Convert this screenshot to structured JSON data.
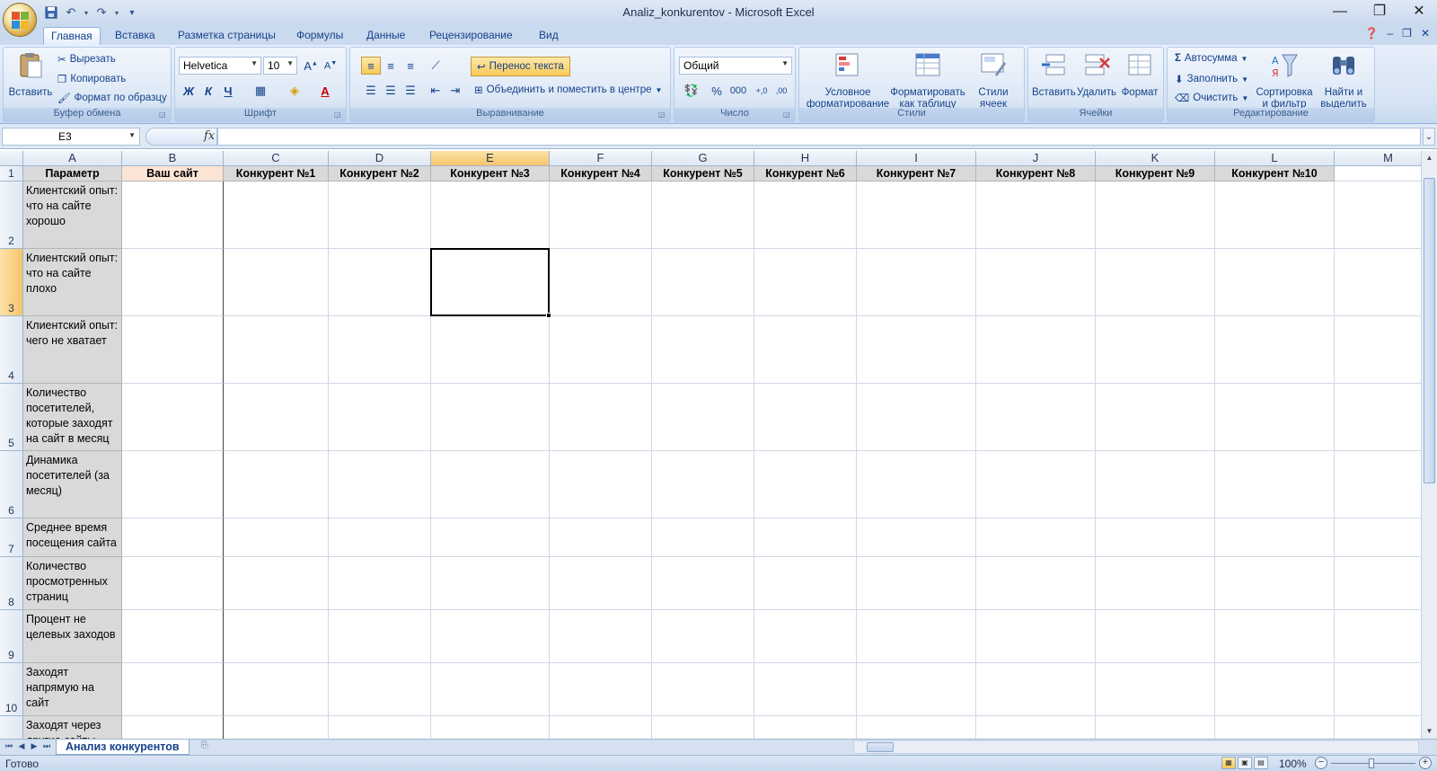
{
  "window": {
    "title": "Analiz_konkurentov - Microsoft Excel",
    "controls": [
      "—",
      "❐",
      "✕"
    ]
  },
  "tabs": [
    "Главная",
    "Вставка",
    "Разметка страницы",
    "Формулы",
    "Данные",
    "Рецензирование",
    "Вид"
  ],
  "active_tab": "Главная",
  "ribbon": {
    "clipboard": {
      "label": "Буфер обмена",
      "paste": "Вставить",
      "cut": "Вырезать",
      "copy": "Копировать",
      "format_painter": "Формат по образцу"
    },
    "font": {
      "label": "Шрифт",
      "font_name": "Helvetica",
      "font_size": "10",
      "bold": "Ж",
      "italic": "К",
      "underline": "Ч"
    },
    "alignment": {
      "label": "Выравнивание",
      "wrap_text": "Перенос текста",
      "merge_center": "Объединить и поместить в центре"
    },
    "number": {
      "label": "Число",
      "format": "Общий",
      "percent": "%",
      "thousands": "000",
      "inc_decimal": "+,0",
      "dec_decimal": ",00"
    },
    "styles": {
      "label": "Стили",
      "conditional_1": "Условное",
      "conditional_2": "форматирование",
      "as_table_1": "Форматировать",
      "as_table_2": "как таблицу",
      "cell_styles_1": "Стили",
      "cell_styles_2": "ячеек"
    },
    "cells": {
      "label": "Ячейки",
      "insert": "Вставить",
      "delete": "Удалить",
      "format": "Формат"
    },
    "editing": {
      "label": "Редактирование",
      "autosum": "Автосумма",
      "fill": "Заполнить",
      "clear": "Очистить",
      "sort_1": "Сортировка",
      "sort_2": "и фильтр",
      "find_1": "Найти и",
      "find_2": "выделить"
    }
  },
  "formula_bar": {
    "name_box": "E3",
    "fx": "fx",
    "formula": ""
  },
  "sheet": {
    "columns": [
      "A",
      "B",
      "C",
      "D",
      "E",
      "F",
      "G",
      "H",
      "I",
      "J",
      "K",
      "L",
      "M"
    ],
    "selected_column": "E",
    "row_numbers": [
      "1",
      "2",
      "3",
      "4",
      "5",
      "6",
      "7",
      "8",
      "9",
      "10"
    ],
    "selected_row": "3",
    "header_row": [
      "Параметр",
      "Ваш сайт",
      "Конкурент №1",
      "Конкурент №2",
      "Конкурент №3",
      "Конкурент №4",
      "Конкурент №5",
      "Конкурент №6",
      "Конкурент №7",
      "Конкурент №8",
      "Конкурент №9",
      "Конкурент №10"
    ],
    "parameters": [
      "Клиентский опыт: что на сайте хорошо",
      "Клиентский опыт: что на сайте плохо",
      "Клиентский опыт: чего не хватает",
      "Количество посетителей, которые заходят на сайт в месяц",
      "Динамика посетителей (за месяц)",
      "Среднее время посещения сайта",
      "Количество просмотренных страниц",
      "Процент не целевых заходов",
      "Заходят напрямую на сайт",
      "Заходят через другие сайты"
    ],
    "active_cell": "E3"
  },
  "sheet_tabs": [
    "Анализ конкурентов"
  ],
  "status": {
    "ready": "Готово",
    "zoom": "100%"
  }
}
